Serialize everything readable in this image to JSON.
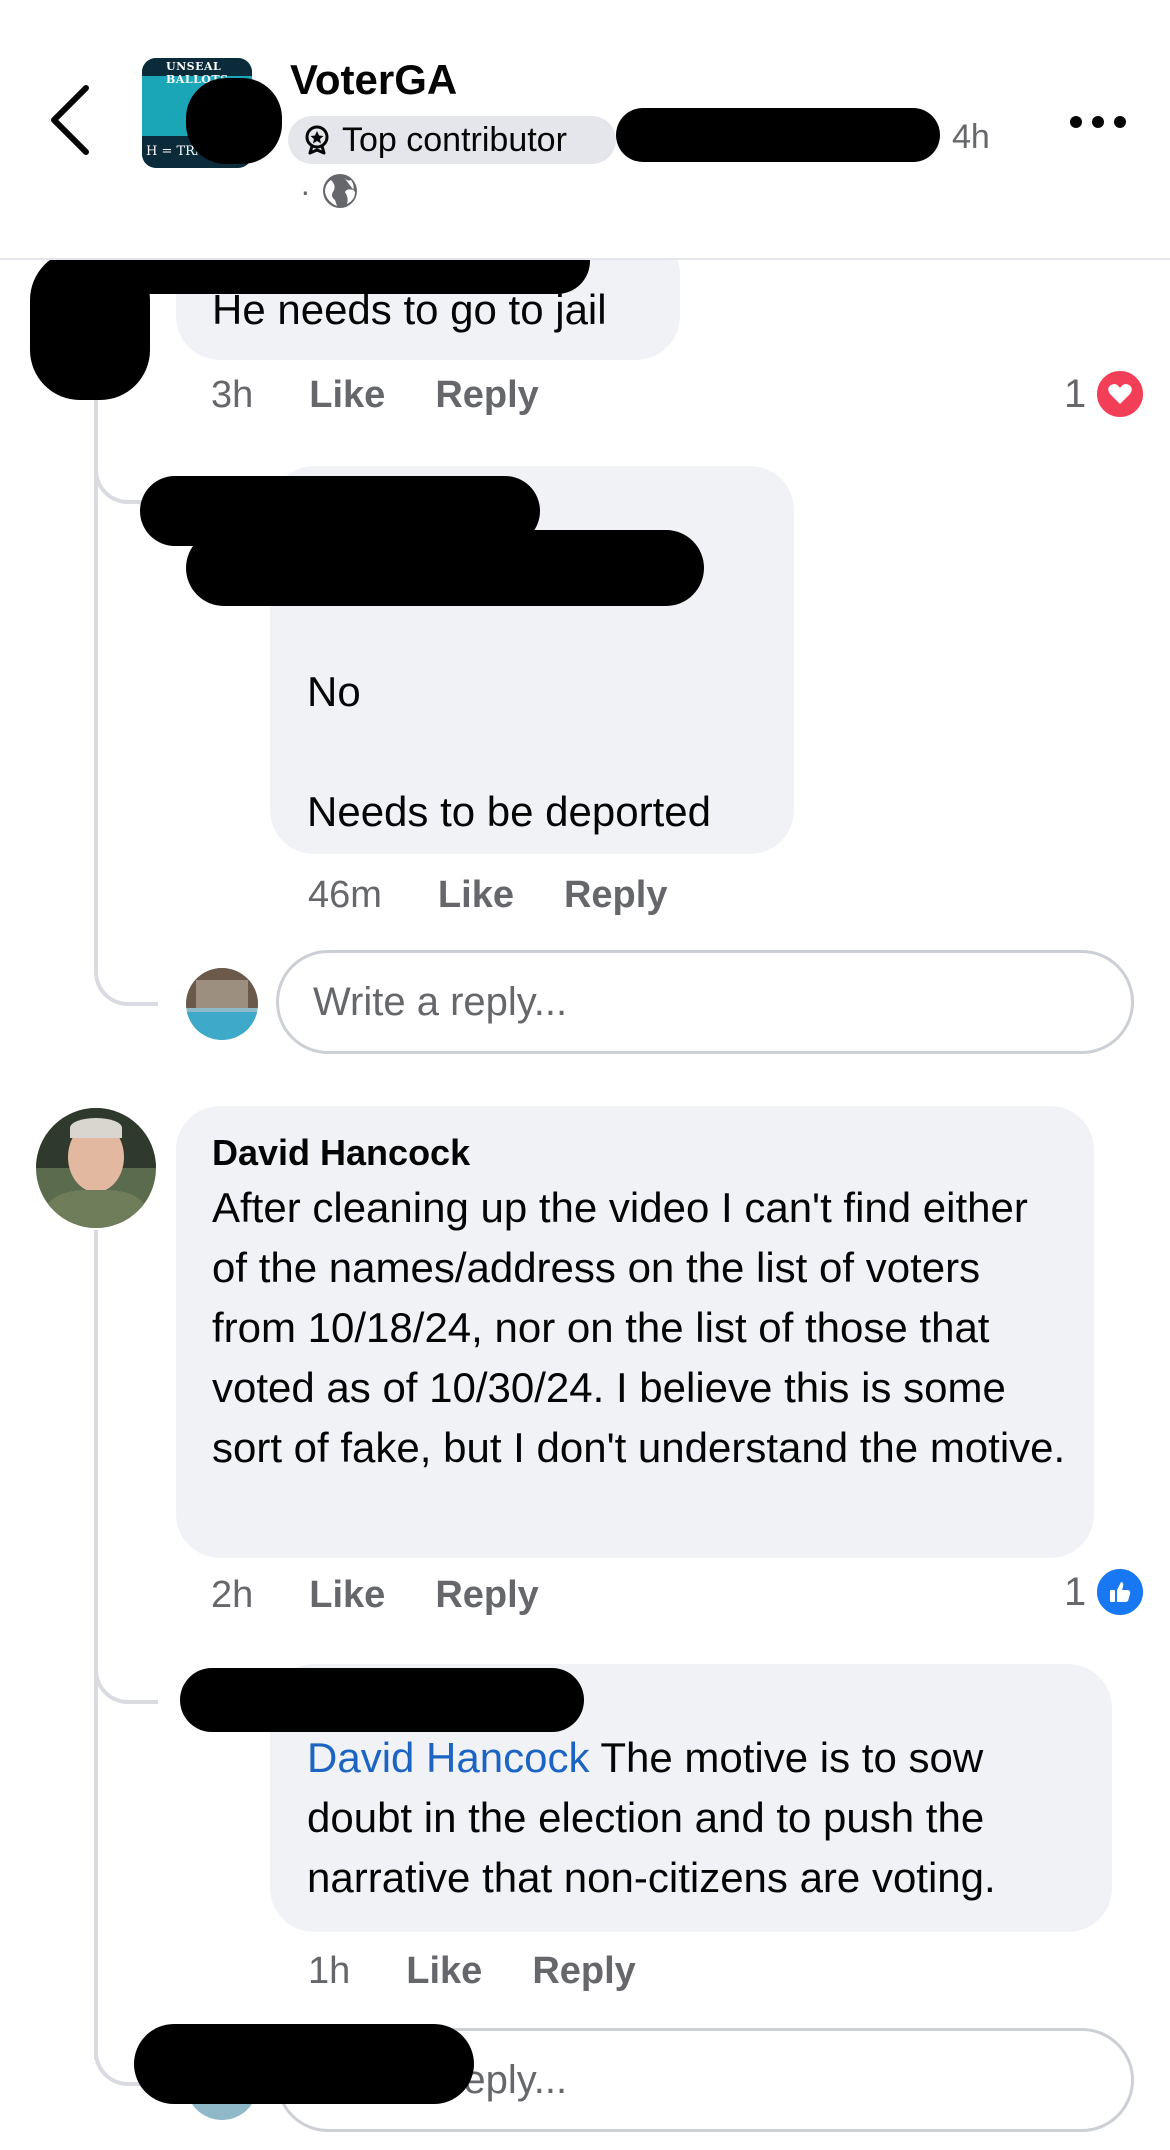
{
  "header": {
    "page_name": "VoterGA",
    "badge_label": "Top contributor",
    "post_time": "4h",
    "separator": "·",
    "avatar_text_top": "UNSEAL BALLOTS",
    "avatar_text_bottom": "H = TRA"
  },
  "comments": [
    {
      "text": "He needs to go to jail",
      "time": "3h",
      "like_label": "Like",
      "reply_label": "Reply",
      "reaction_count": "1",
      "reaction_type": "love",
      "replies": [
        {
          "line1": "No",
          "line2": "Needs to be deported",
          "time": "46m",
          "like_label": "Like",
          "reply_label": "Reply"
        }
      ],
      "reply_placeholder": "Write a reply..."
    },
    {
      "author": "David Hancock",
      "text": "After cleaning up the video I can't find either of the names/address on the list of voters from 10/18/24, nor on the list of those that voted as of 10/30/24.  I believe this is some sort of fake, but I don't understand the motive.",
      "time": "2h",
      "like_label": "Like",
      "reply_label": "Reply",
      "reaction_count": "1",
      "reaction_type": "like",
      "replies": [
        {
          "mention": "David Hancock",
          "text": " The motive is to sow doubt in the election and to push the narrative that non-citizens are voting.",
          "time": "1h",
          "like_label": "Like",
          "reply_label": "Reply"
        }
      ],
      "reply_placeholder": "Write a reply..."
    }
  ],
  "colors": {
    "bubble": "#f0f2f5",
    "mention": "#1b64c4",
    "love": "#f33e58",
    "like": "#1877f2",
    "meta": "#65676b"
  }
}
